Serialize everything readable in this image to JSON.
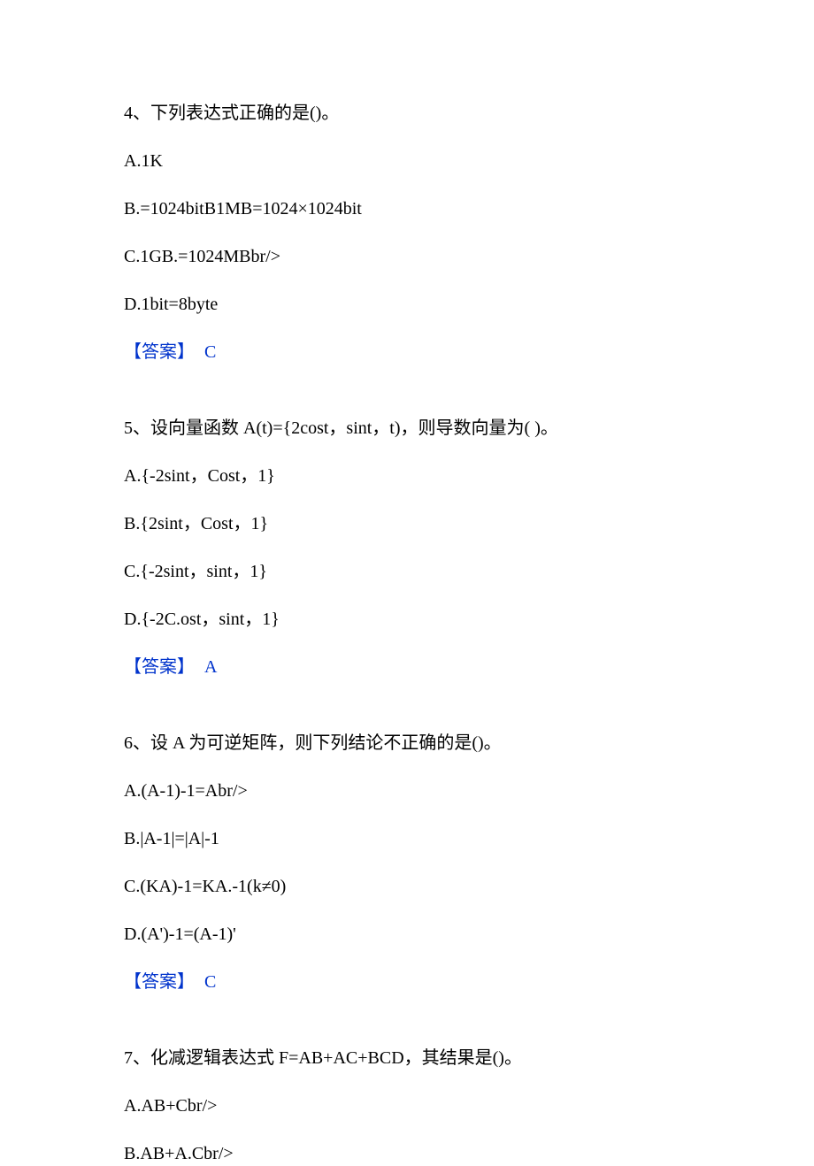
{
  "questions": [
    {
      "stem": "4、下列表达式正确的是()。",
      "options": [
        "A.1K",
        "B.=1024bitB1MB=1024×1024bit",
        "C.1GB.=1024MBbr/>",
        "D.1bit=8byte"
      ],
      "answer_label": "【答案】",
      "answer_value": "C"
    },
    {
      "stem": "5、设向量函数 A(t)={2cost，sint，t)，则导数向量为( )。",
      "options": [
        "A.{-2sint，Cost，1}",
        "B.{2sint，Cost，1}",
        "C.{-2sint，sint，1}",
        "D.{-2C.ost，sint，1}"
      ],
      "answer_label": "【答案】",
      "answer_value": "A"
    },
    {
      "stem": "6、设 A 为可逆矩阵，则下列结论不正确的是()。",
      "options": [
        "A.(A-1)-1=Abr/>",
        "B.|A-1|=|A|-1",
        "C.(KA)-1=KA.-1(k≠0)",
        "D.(A')-1=(A-1)'"
      ],
      "answer_label": "【答案】",
      "answer_value": "C"
    },
    {
      "stem": "7、化减逻辑表达式 F=AB+AC+BCD，其结果是()。",
      "options": [
        "A.AB+Cbr/>",
        "B.AB+A.Cbr/>"
      ],
      "answer_label": "",
      "answer_value": ""
    }
  ]
}
